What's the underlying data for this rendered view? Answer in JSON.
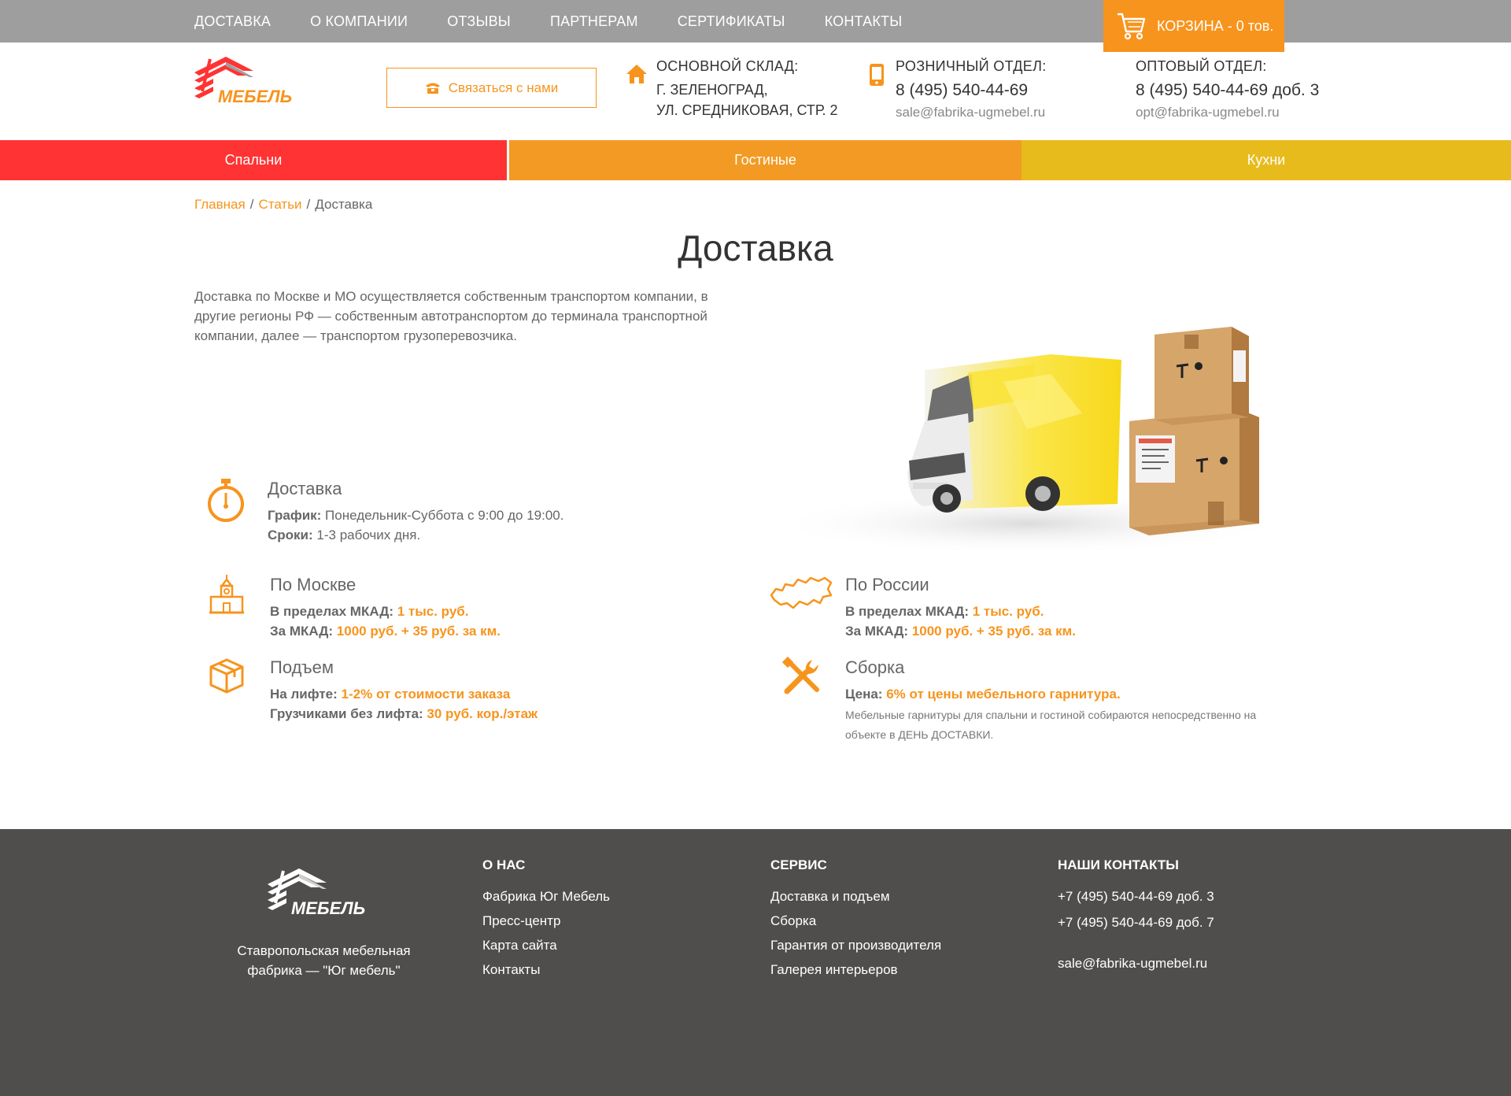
{
  "topnav": [
    "ДОСТАВКА",
    "О КОМПАНИИ",
    "ОТЗЫВЫ",
    "ПАРТНЕРАМ",
    "СЕРТИФИКАТЫ",
    "КОНТАКТЫ"
  ],
  "cart": {
    "label": "КОРЗИНА - 0 тов."
  },
  "header": {
    "contact_button": "Связаться с нами",
    "warehouse": {
      "label": "ОСНОВНОЙ СКЛАД:",
      "line1": "Г. ЗЕЛЕНОГРАД,",
      "line2": "УЛ. СРЕДНИКОВАЯ, СТР. 2"
    },
    "retail": {
      "label": "РОЗНИЧНЫЙ ОТДЕЛ:",
      "phone": "8 (495) 540-44-69",
      "email": "sale@fabrika-ugmebel.ru"
    },
    "wholesale": {
      "label": "ОПТОВЫЙ ОТДЕЛ:",
      "phone": "8 (495) 540-44-69 доб. 3",
      "email": "opt@fabrika-ugmebel.ru"
    }
  },
  "categories": [
    "Спальни",
    "Гостиные",
    "Кухни"
  ],
  "breadcrumb": {
    "home": "Главная",
    "articles": "Статьи",
    "current": "Доставка"
  },
  "page": {
    "title": "Доставка",
    "intro": "Доставка по Москве и МО осуществляется собственным транспортом компании, в другие регионы РФ — собственным автотранспортом до терминала транспортной компании, далее — транспортом грузоперевозчика."
  },
  "blocks": {
    "delivery": {
      "title": "Доставка",
      "l1_label": "График:",
      "l1_value": " Понедельник-Суббота с 9:00 до 19:00.",
      "l2_label": "Сроки:",
      "l2_value": " 1-3 рабочих дня."
    },
    "moscow": {
      "title": "По Москве",
      "l1_label": "В пределах МКАД:",
      "l1_value": "1 тыс. руб.",
      "l2_label": "За МКАД:",
      "l2_value": "1000 руб. + 35 руб. за км."
    },
    "russia": {
      "title": "По России",
      "l1_label": "В пределах МКАД:",
      "l1_value": "1 тыс. руб.",
      "l2_label": "За МКАД:",
      "l2_value": "1000 руб. + 35 руб. за км."
    },
    "lift": {
      "title": "Подъем",
      "l1_label": "На лифте:",
      "l1_value": "1-2% от стоимости заказа",
      "l2_label": "Грузчиками без лифта:",
      "l2_value": "30 руб. кор./этаж"
    },
    "assembly": {
      "title": "Сборка",
      "l1_label": "Цена:",
      "l1_value": "6% от цены мебельного гарнитура.",
      "note": "Мебельные гарнитуры для спальни и гостиной собираются непосредственно на объекте в ДЕНЬ ДОСТАВКИ."
    }
  },
  "footer": {
    "description": "Ставропольская мебельная фабрика — \"Юг мебель\"",
    "about": {
      "heading": "О НАС",
      "links": [
        "Фабрика Юг Мебель",
        "Пресс-центр",
        "Карта сайта",
        "Контакты"
      ]
    },
    "service": {
      "heading": "СЕРВИС",
      "links": [
        "Доставка и подъем",
        "Сборка",
        "Гарантия от производителя",
        "Галерея интерьеров"
      ]
    },
    "contacts": {
      "heading": "НАШИ КОНТАКТЫ",
      "phone1": "+7 (495) 540-44-69 доб. 3",
      "phone2": "+7 (495) 540-44-69 доб. 7",
      "email": "sale@fabrika-ugmebel.ru"
    }
  },
  "logo_text": "МЕБЕЛЬ",
  "colors": {
    "accent": "#f7941d",
    "red": "#ff3333",
    "orange": "#f39a24",
    "yellow": "#e8bb1d",
    "topbar": "#9e9e9e",
    "footer": "#4f4e4c"
  }
}
